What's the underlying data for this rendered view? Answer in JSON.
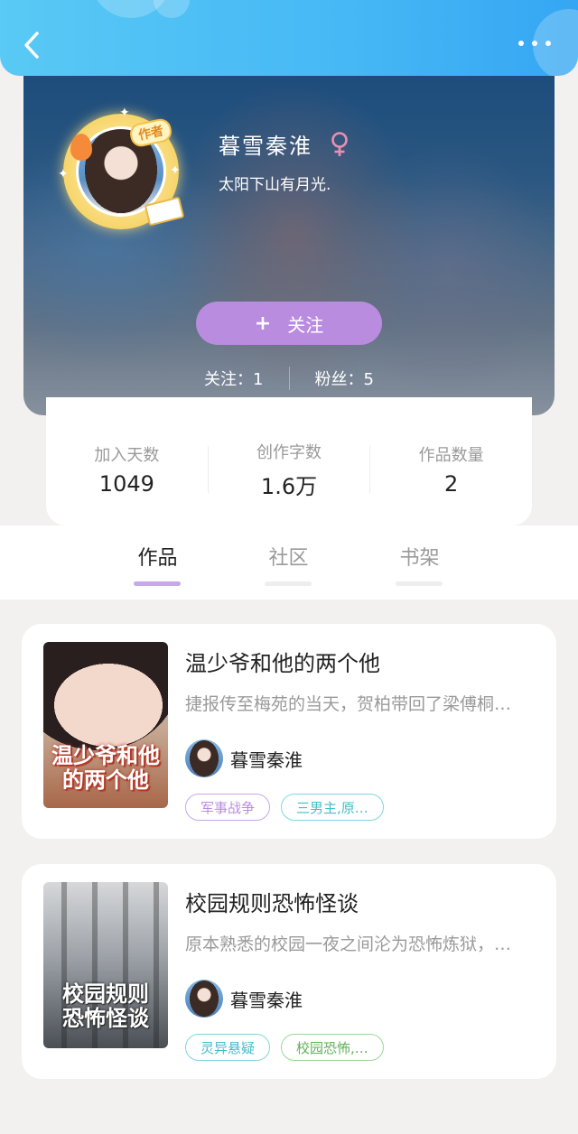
{
  "nav": {
    "back_icon": "chevron-left-icon",
    "more_icon": "more-dots-icon"
  },
  "profile": {
    "name": "暮雪秦淮",
    "gender_icon": "female-icon",
    "signature": "太阳下山有月光.",
    "avatar_badge": "作者",
    "follow_button": {
      "plus": "+",
      "label": "关注"
    },
    "following": "关注：1",
    "fans": "粉丝：5"
  },
  "stats": [
    {
      "label": "加入天数",
      "value": "1049"
    },
    {
      "label": "创作字数",
      "value": "1.6万"
    },
    {
      "label": "作品数量",
      "value": "2"
    }
  ],
  "tabs": [
    {
      "label": "作品",
      "active": true
    },
    {
      "label": "社区",
      "active": false
    },
    {
      "label": "书架",
      "active": false
    }
  ],
  "books": [
    {
      "title": "温少爷和他的两个他",
      "desc": "捷报传至梅苑的当天，贺柏带回了梁傅桐…",
      "author": "暮雪秦淮",
      "cover_text": "温少爷和他的两个他",
      "tags": [
        {
          "label": "军事战争",
          "color": "#c9a6e6",
          "text_color": "#b98ce0"
        },
        {
          "label": "三男主,原…",
          "color": "#7fd6de",
          "text_color": "#47bcc8"
        }
      ]
    },
    {
      "title": "校园规则恐怖怪谈",
      "desc": "原本熟悉的校园一夜之间沦为恐怖炼狱，…",
      "author": "暮雪秦淮",
      "cover_text": "校园规则恐怖怪谈",
      "tags": [
        {
          "label": "灵异悬疑",
          "color": "#7fd6de",
          "text_color": "#47bcc8"
        },
        {
          "label": "校园恐怖,…",
          "color": "#9fd49a",
          "text_color": "#5fb157"
        }
      ]
    }
  ],
  "colors": {
    "header": "#46b8f5",
    "accent_purple": "#b98ce0",
    "page_bg": "#f2f1ef"
  }
}
